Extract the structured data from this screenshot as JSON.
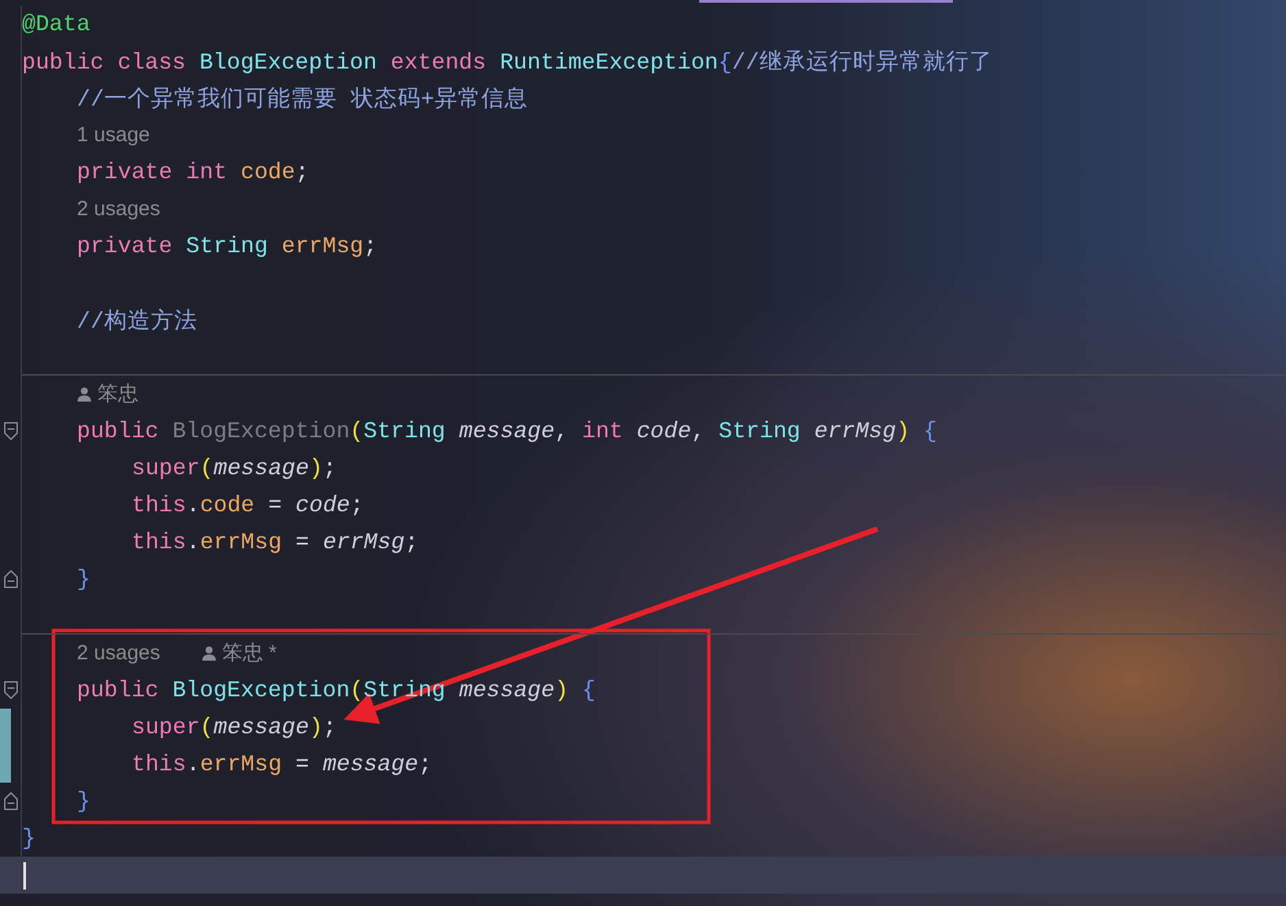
{
  "editor": {
    "lines": [
      {
        "kind": "code",
        "tokens": [
          {
            "t": "@Data",
            "kind": "annotation"
          }
        ]
      },
      {
        "kind": "code",
        "tokens": [
          {
            "t": "public ",
            "kind": "keyword"
          },
          {
            "t": "class ",
            "kind": "keyword"
          },
          {
            "t": "BlogException ",
            "kind": "type"
          },
          {
            "t": "extends ",
            "kind": "keyword"
          },
          {
            "t": "RuntimeException",
            "kind": "type"
          },
          {
            "t": "{",
            "kind": "brace"
          },
          {
            "t": "//继承运行时异常就行了",
            "kind": "comment"
          }
        ],
        "children": [
          {
            "kind": "code",
            "tokens": [
              {
                "t": "//一个异常我们可能需要 状态码+异常信息",
                "kind": "comment"
              }
            ]
          },
          {
            "kind": "hint",
            "tokens": [
              {
                "t": "1 usage",
                "kind": "usages"
              }
            ]
          },
          {
            "kind": "code",
            "tokens": [
              {
                "t": "private ",
                "kind": "keyword"
              },
              {
                "t": "int ",
                "kind": "keyword"
              },
              {
                "t": "code",
                "kind": "field"
              },
              {
                "t": ";",
                "kind": "plain"
              }
            ]
          },
          {
            "kind": "hint",
            "tokens": [
              {
                "t": "2 usages",
                "kind": "usages"
              }
            ]
          },
          {
            "kind": "code",
            "tokens": [
              {
                "t": "private ",
                "kind": "keyword"
              },
              {
                "t": "String ",
                "kind": "type"
              },
              {
                "t": "errMsg",
                "kind": "field"
              },
              {
                "t": ";",
                "kind": "plain"
              }
            ]
          },
          {
            "kind": "blank"
          },
          {
            "kind": "code",
            "tokens": [
              {
                "t": "//构造方法",
                "kind": "comment"
              }
            ]
          },
          {
            "kind": "blank"
          },
          {
            "kind": "divider"
          },
          {
            "kind": "hint",
            "tokens": [
              {
                "t": "笨忠",
                "kind": "author"
              }
            ]
          },
          {
            "kind": "code",
            "foldable": true,
            "tokens": [
              {
                "t": "public ",
                "kind": "keyword"
              },
              {
                "t": "BlogException",
                "kind": "unused"
              },
              {
                "t": "(",
                "kind": "paren"
              },
              {
                "t": "String ",
                "kind": "type"
              },
              {
                "t": "message",
                "kind": "param"
              },
              {
                "t": ", ",
                "kind": "plain"
              },
              {
                "t": "int ",
                "kind": "keyword"
              },
              {
                "t": "code",
                "kind": "param"
              },
              {
                "t": ", ",
                "kind": "plain"
              },
              {
                "t": "String ",
                "kind": "type"
              },
              {
                "t": "errMsg",
                "kind": "param"
              },
              {
                "t": ") ",
                "kind": "paren"
              },
              {
                "t": "{",
                "kind": "brace"
              }
            ],
            "children": [
              {
                "kind": "code",
                "tokens": [
                  {
                    "t": "super",
                    "kind": "keyword"
                  },
                  {
                    "t": "(",
                    "kind": "paren"
                  },
                  {
                    "t": "message",
                    "kind": "param"
                  },
                  {
                    "t": ")",
                    "kind": "paren"
                  },
                  {
                    "t": ";",
                    "kind": "plain"
                  }
                ]
              },
              {
                "kind": "code",
                "tokens": [
                  {
                    "t": "this",
                    "kind": "keyword"
                  },
                  {
                    "t": ".",
                    "kind": "plain"
                  },
                  {
                    "t": "code",
                    "kind": "field"
                  },
                  {
                    "t": " = ",
                    "kind": "plain"
                  },
                  {
                    "t": "code",
                    "kind": "param"
                  },
                  {
                    "t": ";",
                    "kind": "plain"
                  }
                ]
              },
              {
                "kind": "code",
                "tokens": [
                  {
                    "t": "this",
                    "kind": "keyword"
                  },
                  {
                    "t": ".",
                    "kind": "plain"
                  },
                  {
                    "t": "errMsg",
                    "kind": "field"
                  },
                  {
                    "t": " = ",
                    "kind": "plain"
                  },
                  {
                    "t": "errMsg",
                    "kind": "param"
                  },
                  {
                    "t": ";",
                    "kind": "plain"
                  }
                ]
              }
            ]
          },
          {
            "kind": "code",
            "foldable": true,
            "tokens": [
              {
                "t": "}",
                "kind": "brace"
              }
            ]
          },
          {
            "kind": "blank"
          },
          {
            "kind": "divider"
          },
          {
            "kind": "hint",
            "tokens": [
              {
                "t": "2 usages",
                "kind": "usages"
              },
              {
                "t": "笨忠 *",
                "kind": "author"
              }
            ]
          },
          {
            "kind": "code",
            "foldable": true,
            "tokens": [
              {
                "t": "public ",
                "kind": "keyword"
              },
              {
                "t": "BlogException",
                "kind": "type"
              },
              {
                "t": "(",
                "kind": "paren"
              },
              {
                "t": "String ",
                "kind": "type"
              },
              {
                "t": "message",
                "kind": "param"
              },
              {
                "t": ") ",
                "kind": "paren"
              },
              {
                "t": "{",
                "kind": "brace"
              }
            ],
            "children": [
              {
                "kind": "code",
                "modified": true,
                "tokens": [
                  {
                    "t": "super",
                    "kind": "keyword"
                  },
                  {
                    "t": "(",
                    "kind": "paren"
                  },
                  {
                    "t": "message",
                    "kind": "param"
                  },
                  {
                    "t": ")",
                    "kind": "paren"
                  },
                  {
                    "t": ";",
                    "kind": "plain"
                  }
                ]
              },
              {
                "kind": "code",
                "modified": true,
                "tokens": [
                  {
                    "t": "this",
                    "kind": "keyword"
                  },
                  {
                    "t": ".",
                    "kind": "plain"
                  },
                  {
                    "t": "errMsg",
                    "kind": "field"
                  },
                  {
                    "t": " = ",
                    "kind": "plain"
                  },
                  {
                    "t": "message",
                    "kind": "param"
                  },
                  {
                    "t": ";",
                    "kind": "plain"
                  }
                ]
              }
            ]
          },
          {
            "kind": "code",
            "foldable": true,
            "tokens": [
              {
                "t": "}",
                "kind": "brace"
              }
            ]
          }
        ]
      },
      {
        "kind": "code",
        "tokens": [
          {
            "t": "}",
            "kind": "brace"
          }
        ]
      },
      {
        "kind": "caret"
      }
    ]
  }
}
